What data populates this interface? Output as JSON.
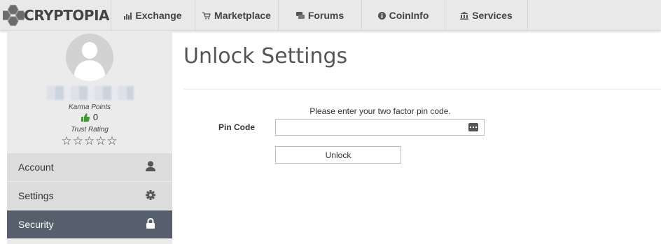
{
  "brand": {
    "name": "CRYPTOPIA"
  },
  "nav": {
    "tabs": [
      {
        "label": "Exchange",
        "icon": "bar-chart-icon"
      },
      {
        "label": "Marketplace",
        "icon": "cart-icon"
      },
      {
        "label": "Forums",
        "icon": "chat-icon"
      },
      {
        "label": "CoinInfo",
        "icon": "info-icon"
      },
      {
        "label": "Services",
        "icon": "bank-icon"
      }
    ]
  },
  "sidebar": {
    "karma_label": "Karma Points",
    "karma_value": "0",
    "trust_label": "Trust Rating",
    "trust_stars": "☆☆☆☆☆",
    "items": [
      {
        "label": "Account",
        "icon": "user-icon"
      },
      {
        "label": "Settings",
        "icon": "gear-icon"
      },
      {
        "label": "Security",
        "icon": "lock-icon",
        "active": true
      }
    ]
  },
  "main": {
    "title": "Unlock Settings",
    "instruction": "Please enter your two factor pin code.",
    "pin_label": "Pin Code",
    "pin_value": "",
    "unlock_label": "Unlock"
  },
  "colors": {
    "nav_bg": "#e9e9e9",
    "sidebar_bg": "#ebebeb",
    "menu_bg": "#dcdcdc",
    "active_bg": "#56606d",
    "karma_thumb": "#3c9a2e"
  }
}
